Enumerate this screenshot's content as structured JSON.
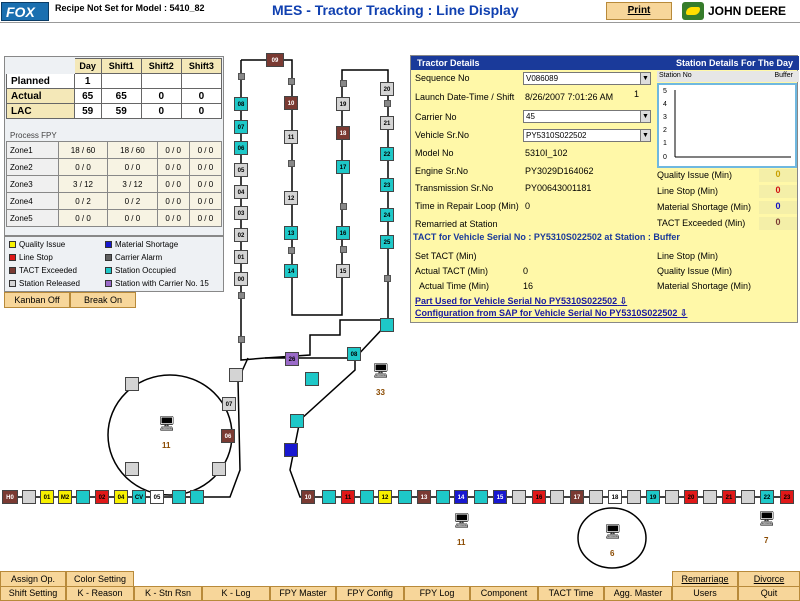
{
  "header": {
    "logo": "FOX",
    "recipe": "Recipe Not Set for Model : 5410_82",
    "title": "MES - Tractor Tracking :  Line Display",
    "print_label": "Print",
    "brand": "JOHN DEERE"
  },
  "stats": {
    "headers": [
      "Day",
      "Shift1",
      "Shift2",
      "Shift3"
    ],
    "rows": [
      {
        "label": "Planned",
        "values": [
          "1",
          "",
          "",
          ""
        ]
      },
      {
        "label": "Actual",
        "values": [
          "65",
          "65",
          "0",
          "0"
        ]
      },
      {
        "label": "LAC",
        "values": [
          "59",
          "59",
          "0",
          "0"
        ]
      }
    ]
  },
  "fpy": {
    "title": "Process FPY",
    "rows": [
      {
        "label": "Zone1",
        "values": [
          "18 / 60",
          "18 / 60",
          "0 / 0",
          "0 / 0"
        ]
      },
      {
        "label": "Zone2",
        "values": [
          "0 / 0",
          "0 / 0",
          "0 / 0",
          "0 / 0"
        ]
      },
      {
        "label": "Zone3",
        "values": [
          "3 / 12",
          "3 / 12",
          "0 / 0",
          "0 / 0"
        ]
      },
      {
        "label": "Zone4",
        "values": [
          "0 / 2",
          "0 / 2",
          "0 / 0",
          "0 / 0"
        ]
      },
      {
        "label": "Zone5",
        "values": [
          "0 / 0",
          "0 / 0",
          "0 / 0",
          "0 / 0"
        ]
      }
    ]
  },
  "legend": [
    {
      "label": "Quality Issue",
      "color": "#f7f000"
    },
    {
      "label": "Material Shortage",
      "color": "#1818d0"
    },
    {
      "label": "Line Stop",
      "color": "#e01818"
    },
    {
      "label": "Carrier Alarm",
      "color": "#606060"
    },
    {
      "label": "TACT Exceeded",
      "color": "#7a3a32"
    },
    {
      "label": "Station Occupied",
      "color": "#1ec8c8"
    },
    {
      "label": "Station Released",
      "color": "#d4d4d4"
    },
    {
      "label": "Station with Carrier No. 15",
      "color": "#9a6ac8"
    }
  ],
  "kanban": {
    "kanban_off": "Kanban Off",
    "break_on": "Break On"
  },
  "details": {
    "header_left": "Tractor Details",
    "header_right": "Station Details For The Day",
    "station_no_label": "Station No",
    "station_value": "Buffer",
    "sequence_label": "Sequence No",
    "sequence_value": "V086089",
    "launch_label": "Launch Date-Time / Shift",
    "launch_value": "8/26/2007 7:01:26 AM",
    "shift_value": "1",
    "carrier_label": "Carrier No",
    "carrier_value": "45",
    "vehicle_label": "Vehicle Sr.No",
    "vehicle_value": "PY5310S022502",
    "model_label": "Model No",
    "model_value": "5310I_102",
    "engine_label": "Engine Sr.No",
    "engine_value": "PY3029D164062",
    "transmission_label": "Transmission Sr.No",
    "transmission_value": "PY00643001181",
    "repair_label": "Time in Repair Loop (Min)",
    "repair_value": "0",
    "remarried_label": "Remarried at Station",
    "graph_ticks": [
      "5",
      "4",
      "3",
      "2",
      "1",
      "0"
    ],
    "station_stats": [
      {
        "label": "Quality Issue (Min)",
        "value": "0",
        "color": "#c8a000"
      },
      {
        "label": "Line Stop (Min)",
        "value": "0",
        "color": "#d01010"
      },
      {
        "label": "Material Shortage (Min)",
        "value": "0",
        "color": "#1010c0"
      },
      {
        "label": "TACT Exceeded (Min)",
        "value": "0",
        "color": "#7a3a32"
      }
    ],
    "tact_title": "TACT for Vehicle Serial No : PY5310S022502 at Station : Buffer",
    "set_tact_label": "Set TACT (Min)",
    "actual_tact_label": "Actual TACT (Min)",
    "actual_tact_value": "0",
    "actual_time_label": "Actual Time (Min)",
    "actual_time_value": "16",
    "tact_right": [
      "Line Stop (Min)",
      "Quality Issue (Min)",
      "Material Shortage (Min)"
    ],
    "link_parts": "Part Used for Vehicle Serial No PY5310S022502",
    "link_config": "Configuration from SAP for Vehicle Serial No PY5310S022502"
  },
  "stations": {
    "left_col": [
      "08",
      "07",
      "06",
      "05",
      "04",
      "03",
      "02",
      "01",
      "00"
    ],
    "top": "09",
    "col2": [
      "10",
      "11",
      "12",
      "13",
      "14"
    ],
    "col3": [
      "19",
      "18",
      "17",
      "16",
      "15"
    ],
    "col4": [
      "20",
      "21",
      "22",
      "23",
      "24",
      "25"
    ],
    "mid": [
      "26",
      "08"
    ],
    "loop": [
      "07",
      "06"
    ],
    "bottom_left": [
      "H0",
      "01",
      "M2",
      "02",
      "04",
      "CV",
      "05"
    ],
    "bottom_right": [
      "10",
      "11",
      "12",
      "13",
      "14",
      "15",
      "16",
      "17",
      "18",
      "19",
      "20",
      "21",
      "22",
      "23"
    ],
    "pc_labels": [
      "33",
      "11",
      "11",
      "6",
      "7"
    ]
  },
  "buttons": {
    "row1": [
      "Assign Op.",
      "Color Setting",
      "Remarriage",
      "Divorce"
    ],
    "row2": [
      "Shift Setting",
      "K - Reason",
      "K - Stn Rsn",
      "K - Log",
      "FPY Master",
      "FPY Config",
      "FPY Log",
      "Component",
      "TACT Time",
      "Agg. Master",
      "Users",
      "Quit"
    ]
  }
}
